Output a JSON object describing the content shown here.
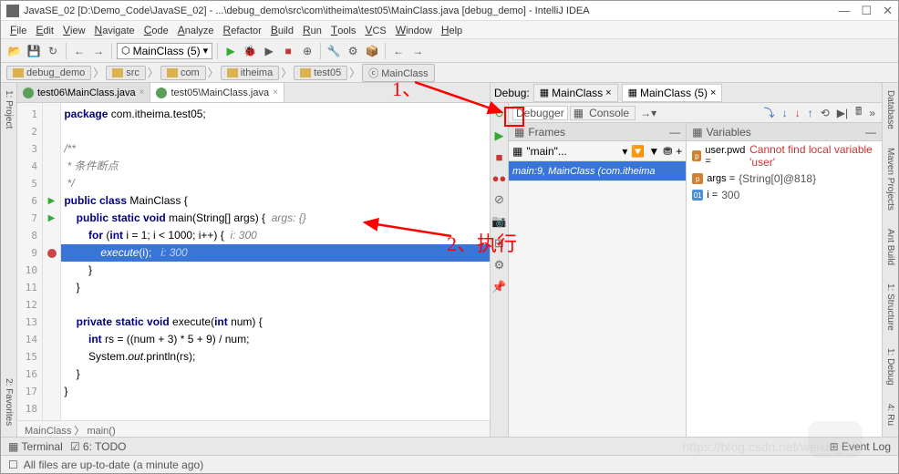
{
  "title": "JavaSE_02 [D:\\Demo_Code\\JavaSE_02] - ...\\debug_demo\\src\\com\\itheima\\test05\\MainClass.java [debug_demo] - IntelliJ IDEA",
  "menu": [
    "File",
    "Edit",
    "View",
    "Navigate",
    "Code",
    "Analyze",
    "Refactor",
    "Build",
    "Run",
    "Tools",
    "VCS",
    "Window",
    "Help"
  ],
  "run_combo": "MainClass (5)",
  "breadcrumb": [
    "debug_demo",
    "src",
    "com",
    "itheima",
    "test05",
    "MainClass"
  ],
  "editor_tabs": [
    {
      "label": "test06\\MainClass.java",
      "active": false
    },
    {
      "label": "test05\\MainClass.java",
      "active": true
    }
  ],
  "code_lines": [
    {
      "n": 1,
      "html": "<span class='kw'>package</span> com.itheima.test05;"
    },
    {
      "n": 2,
      "html": ""
    },
    {
      "n": 3,
      "html": "<span class='cm'>/**</span>"
    },
    {
      "n": 4,
      "html": "<span class='cm'> * 条件断点</span>"
    },
    {
      "n": 5,
      "html": "<span class='cm'> */</span>"
    },
    {
      "n": 6,
      "html": "<span class='kw'>public class</span> MainClass {"
    },
    {
      "n": 7,
      "html": "    <span class='kw'>public static void</span> main(String[] args) {  <span class='cm'>args: {}</span>"
    },
    {
      "n": 8,
      "html": "        <span class='kw'>for</span> (<span class='kw'>int</span> i = 1; i &lt; 1000; i++) {  <span class='cm'>i: 300</span>"
    },
    {
      "n": 9,
      "html": "            <span style='font-style:italic'>execute</span>(i);   <span class='cm'>i: 300</span>",
      "exec": true
    },
    {
      "n": 10,
      "html": "        }"
    },
    {
      "n": 11,
      "html": "    }"
    },
    {
      "n": 12,
      "html": ""
    },
    {
      "n": 13,
      "html": "    <span class='kw'>private static void</span> execute(<span class='kw'>int</span> num) {"
    },
    {
      "n": 14,
      "html": "        <span class='kw'>int</span> rs = ((num + 3) * 5 + 9) / num;"
    },
    {
      "n": 15,
      "html": "        System.<span style='font-style:italic'>out</span>.println(rs);"
    },
    {
      "n": 16,
      "html": "    }"
    },
    {
      "n": 17,
      "html": "}"
    },
    {
      "n": 18,
      "html": ""
    }
  ],
  "code_crumb": "MainClass 〉 main()",
  "debug": {
    "label": "Debug:",
    "tabs": [
      {
        "label": "MainClass"
      },
      {
        "label": "MainClass (5)",
        "active": true
      }
    ],
    "sub_tabs": [
      {
        "label": "Debugger",
        "active": true
      },
      {
        "label": "Console"
      }
    ],
    "frames_title": "Frames",
    "vars_title": "Variables",
    "thread": "\"main\"...",
    "frame": "main:9, MainClass (com.itheima",
    "vars": [
      {
        "ico": "#d08030",
        "t": "p",
        "name": "user.pwd",
        "val": "Cannot find local variable 'user'",
        "err": true
      },
      {
        "ico": "#d08030",
        "t": "p",
        "name": "args",
        "val": "{String[0]@818}"
      },
      {
        "ico": "#4a90d9",
        "t": "01",
        "name": "i",
        "val": "300"
      }
    ]
  },
  "bottom": {
    "terminal": "Terminal",
    "todo": "6: TODO",
    "eventlog": "Event Log"
  },
  "status": "All files are up-to-date (a minute ago)",
  "annot1": "1、",
  "annot2": "2、执行",
  "watermark": "https://blog.csdn.net/weixin_...",
  "side_left": [
    "1: Project",
    "2: Favorites"
  ],
  "side_right": [
    "Database",
    "Maven Projects",
    "Ant Build",
    "1: Structure",
    "1: Debug",
    "4: Ru"
  ]
}
